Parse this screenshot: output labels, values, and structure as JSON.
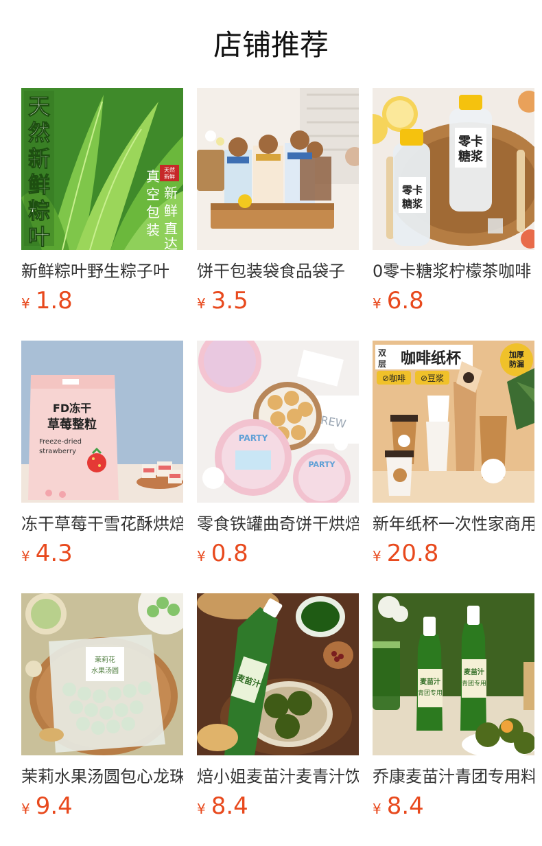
{
  "page": {
    "title": "店铺推荐"
  },
  "currency_symbol": "¥",
  "colors": {
    "price": "#e8491d",
    "title": "#111111",
    "name": "#333333"
  },
  "products": [
    {
      "name": "新鲜粽叶野生粽子叶",
      "price": "1.8",
      "image_text": {
        "main": "天然新鲜粽叶",
        "tag": "真空包装",
        "tag2": "新鲜直达",
        "seal": "天然新鲜"
      }
    },
    {
      "name": "饼干包装袋食品袋子",
      "price": "3.5"
    },
    {
      "name": "0零卡糖浆柠檬茶咖啡",
      "price": "6.8",
      "image_text": {
        "label": "零卡糖浆"
      }
    },
    {
      "name": "冻干草莓干雪花酥烘焙",
      "price": "4.3",
      "image_text": {
        "label_top": "FD冻干",
        "label_mid": "草莓整粒",
        "label_en1": "Freeze-dried",
        "label_en2": "strawberry"
      }
    },
    {
      "name": "零食铁罐曲奇饼干烘焙",
      "price": "0.8",
      "image_text": {
        "tin": "PARTY"
      }
    },
    {
      "name": "新年纸杯一次性家商用",
      "price": "20.8",
      "image_text": {
        "badge_left": "双层",
        "banner": "咖啡纸杯",
        "badge_right": "加厚防漏",
        "chip1": "咖啡",
        "chip2": "豆浆"
      }
    },
    {
      "name": "茉莉水果汤圆包心龙珠",
      "price": "9.4"
    },
    {
      "name": "焙小姐麦苗汁麦青汁饮",
      "price": "8.4",
      "image_text": {
        "bottle": "麦苗汁"
      }
    },
    {
      "name": "乔康麦苗汁青团专用料",
      "price": "8.4"
    }
  ]
}
